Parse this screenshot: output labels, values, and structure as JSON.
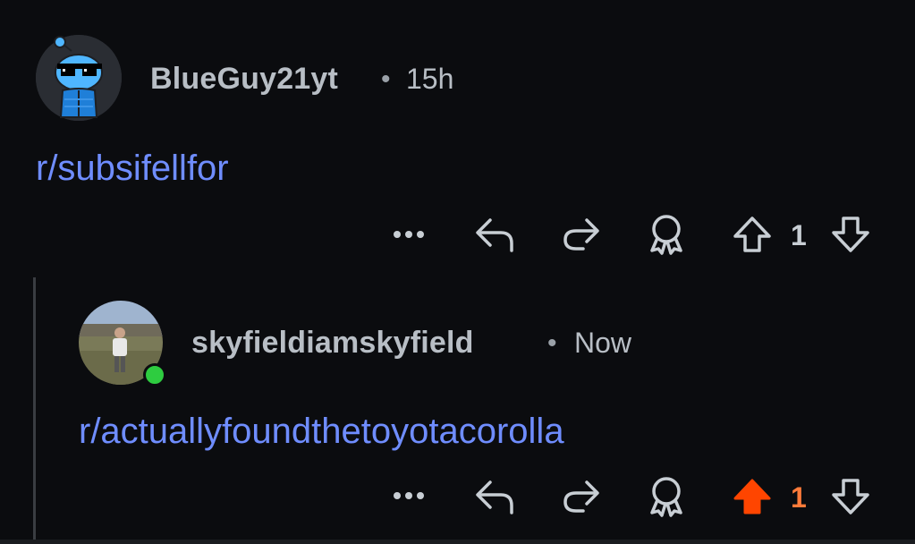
{
  "comments": [
    {
      "username": "BlueGuy21yt",
      "separator": "•",
      "time": "15h",
      "text": "r/subsifellfor",
      "votes": "1",
      "upvoted": false
    },
    {
      "username": "skyfieldiamskyfield",
      "separator": "•",
      "time": "Now",
      "text": "r/actuallyfoundthetoyotacorolla",
      "votes": "1",
      "upvoted": true,
      "online": true
    }
  ],
  "actions": {
    "more": "more-icon",
    "reply": "reply-icon",
    "share": "share-icon",
    "award": "award-icon",
    "upvote": "upvote-icon",
    "downvote": "downvote-icon"
  },
  "colors": {
    "link": "#6f8dff",
    "upvote_active": "#ff4500",
    "count_active": "#ff7b3a",
    "online": "#2ecc40"
  }
}
